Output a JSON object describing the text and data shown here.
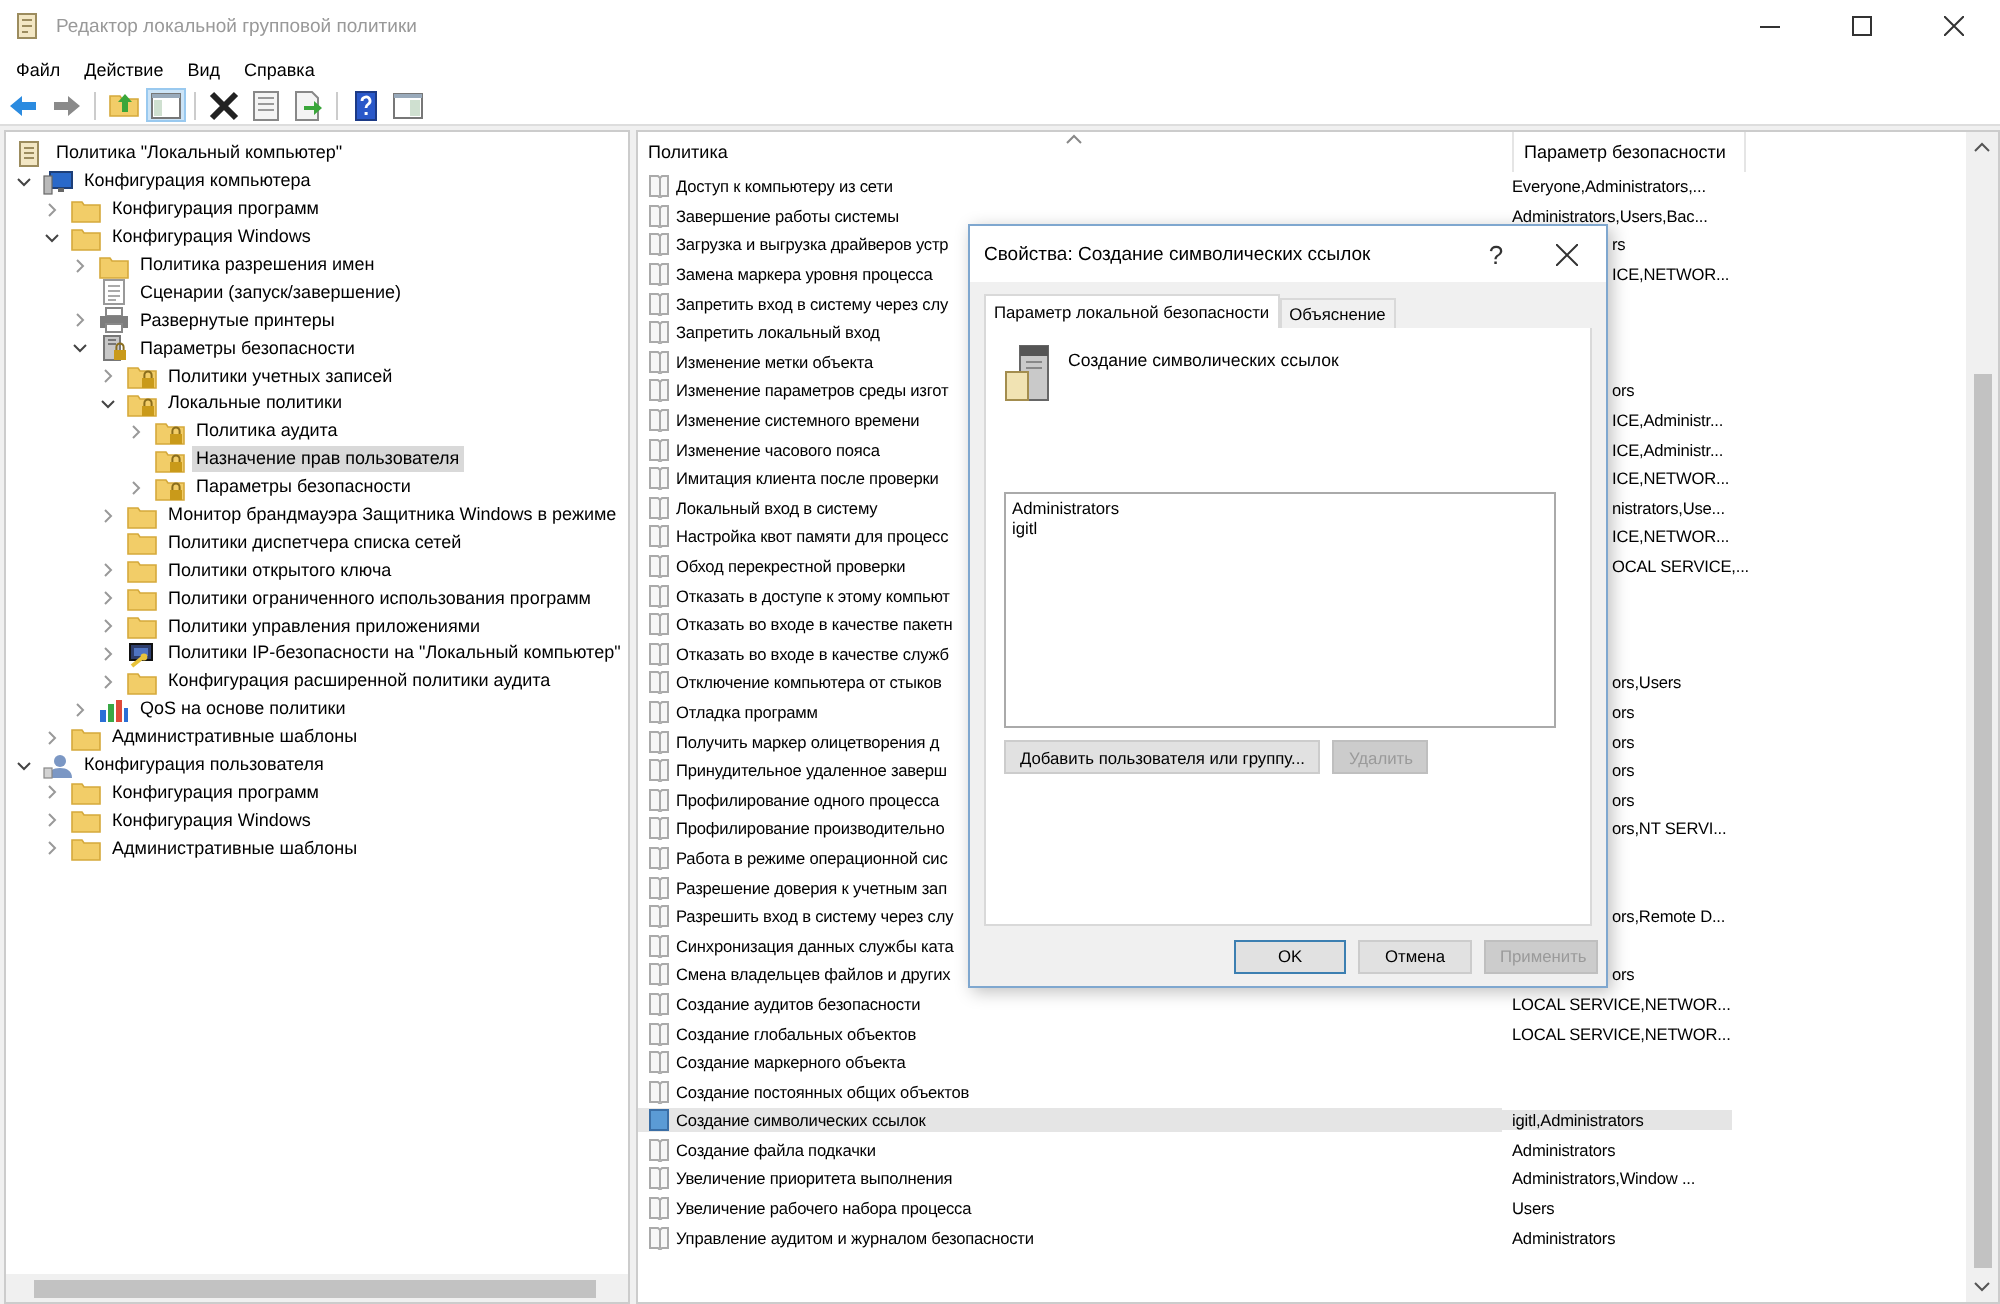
{
  "window": {
    "title": "Редактор локальной групповой политики"
  },
  "menu": [
    "Файл",
    "Действие",
    "Вид",
    "Справка"
  ],
  "toolbar": [
    {
      "kind": "back",
      "pressed": false
    },
    {
      "kind": "forward",
      "pressed": false
    },
    {
      "kind": "up",
      "pressed": false
    },
    {
      "kind": "tree",
      "pressed": true
    },
    {
      "kind": "delete",
      "pressed": false
    },
    {
      "kind": "properties",
      "pressed": false
    },
    {
      "kind": "export",
      "pressed": false
    },
    {
      "kind": "help",
      "pressed": false
    },
    {
      "kind": "pane",
      "pressed": false
    }
  ],
  "tree": [
    {
      "label": "Политика \"Локальный компьютер\"",
      "kind": "policy-doc",
      "selected": false,
      "children": [
        {
          "label": "Конфигурация компьютера",
          "kind": "computer",
          "expanded": true,
          "selected": false,
          "children": [
            {
              "label": "Конфигурация программ",
              "kind": "folder",
              "expanded": false,
              "selected": false
            },
            {
              "label": "Конфигурация Windows",
              "kind": "folder",
              "expanded": true,
              "selected": false,
              "children": [
                {
                  "label": "Политика разрешения имен",
                  "kind": "folder",
                  "expanded": false,
                  "selected": false
                },
                {
                  "label": "Сценарии (запуск/завершение)",
                  "kind": "script",
                  "selected": false
                },
                {
                  "label": "Развернутые принтеры",
                  "kind": "printer",
                  "expanded": false,
                  "selected": false
                },
                {
                  "label": "Параметры безопасности",
                  "kind": "server-lock",
                  "expanded": true,
                  "selected": false,
                  "children": [
                    {
                      "label": "Политики учетных записей",
                      "kind": "lock-folder",
                      "expanded": false,
                      "selected": false
                    },
                    {
                      "label": "Локальные политики",
                      "kind": "lock-folder",
                      "expanded": true,
                      "selected": false,
                      "children": [
                        {
                          "label": "Политика аудита",
                          "kind": "lock-folder",
                          "expanded": false,
                          "selected": false
                        },
                        {
                          "label": "Назначение прав пользователя",
                          "kind": "lock-folder",
                          "selected": true
                        },
                        {
                          "label": "Параметры безопасности",
                          "kind": "lock-folder",
                          "expanded": false,
                          "selected": false
                        }
                      ]
                    },
                    {
                      "label": "Монитор брандмауэра Защитника Windows в режиме",
                      "kind": "folder",
                      "expanded": false,
                      "selected": false
                    },
                    {
                      "label": "Политики диспетчера списка сетей",
                      "kind": "folder",
                      "selected": false
                    },
                    {
                      "label": "Политики открытого ключа",
                      "kind": "folder",
                      "expanded": false,
                      "selected": false
                    },
                    {
                      "label": "Политики ограниченного использования программ",
                      "kind": "folder",
                      "expanded": false,
                      "selected": false
                    },
                    {
                      "label": "Политики управления приложениями",
                      "kind": "folder",
                      "expanded": false,
                      "selected": false
                    },
                    {
                      "label": "Политики IP-безопасности на \"Локальный компьютер\"",
                      "kind": "ipsec",
                      "expanded": false,
                      "selected": false
                    },
                    {
                      "label": "Конфигурация расширенной политики аудита",
                      "kind": "folder",
                      "expanded": false,
                      "selected": false
                    }
                  ]
                },
                {
                  "label": "QoS на основе политики",
                  "kind": "qos",
                  "expanded": false,
                  "selected": false
                }
              ]
            },
            {
              "label": "Административные шаблоны",
              "kind": "folder",
              "expanded": false,
              "selected": false
            }
          ]
        },
        {
          "label": "Конфигурация пользователя",
          "kind": "user",
          "expanded": true,
          "selected": false,
          "children": [
            {
              "label": "Конфигурация программ",
              "kind": "folder",
              "expanded": false,
              "selected": false
            },
            {
              "label": "Конфигурация Windows",
              "kind": "folder",
              "expanded": false,
              "selected": false
            },
            {
              "label": "Административные шаблоны",
              "kind": "folder",
              "expanded": false,
              "selected": false
            }
          ]
        }
      ]
    }
  ],
  "table": {
    "columns": [
      "Политика",
      "Параметр безопасности"
    ],
    "rows": [
      {
        "policy": "Доступ к компьютеру из сети",
        "setting": "Everyone,Administrators,...",
        "selected": false
      },
      {
        "policy": "Завершение работы системы",
        "setting": "Administrators,Users,Bac...",
        "selected": false
      },
      {
        "policy": "Загрузка и выгрузка драйверов устр",
        "setting": "rs",
        "selected": false
      },
      {
        "policy": "Замена маркера уровня процесса",
        "setting": "ICE,NETWOR...",
        "selected": false
      },
      {
        "policy": "Запретить вход в систему через слу",
        "selected": false
      },
      {
        "policy": "Запретить локальный вход",
        "selected": false
      },
      {
        "policy": "Изменение метки объекта",
        "selected": false
      },
      {
        "policy": "Изменение параметров среды изгот",
        "setting": "ors",
        "selected": false
      },
      {
        "policy": "Изменение системного времени",
        "setting": "ICE,Administr...",
        "selected": false
      },
      {
        "policy": "Изменение часового пояса",
        "setting": "ICE,Administr...",
        "selected": false
      },
      {
        "policy": "Имитация клиента после проверки",
        "setting": "ICE,NETWOR...",
        "selected": false
      },
      {
        "policy": "Локальный вход в систему",
        "setting": "nistrators,Use...",
        "selected": false
      },
      {
        "policy": "Настройка квот памяти для процесс",
        "setting": "ICE,NETWOR...",
        "selected": false
      },
      {
        "policy": "Обход перекрестной проверки",
        "setting": "OCAL SERVICE,...",
        "selected": false
      },
      {
        "policy": "Отказать в доступе к этому компьют",
        "selected": false
      },
      {
        "policy": "Отказать во входе в качестве пакетн",
        "selected": false
      },
      {
        "policy": "Отказать во входе в качестве служб",
        "selected": false
      },
      {
        "policy": "Отключение компьютера от стыков",
        "setting": "ors,Users",
        "selected": false
      },
      {
        "policy": "Отладка программ",
        "setting": "ors",
        "selected": false
      },
      {
        "policy": "Получить маркер олицетворения д",
        "setting": "ors",
        "selected": false
      },
      {
        "policy": "Принудительное удаленное заверш",
        "setting": "ors",
        "selected": false
      },
      {
        "policy": "Профилирование одного процесса",
        "setting": "ors",
        "selected": false
      },
      {
        "policy": "Профилирование производительно",
        "setting": "ors,NT SERVI...",
        "selected": false
      },
      {
        "policy": "Работа в режиме операционной сис",
        "selected": false
      },
      {
        "policy": "Разрешение доверия к учетным зап",
        "selected": false
      },
      {
        "policy": "Разрешить вход в систему через слу",
        "setting": "ors,Remote D...",
        "selected": false
      },
      {
        "policy": "Синхронизация данных службы ката",
        "selected": false
      },
      {
        "policy": "Смена владельцев файлов и других",
        "setting": "ors",
        "selected": false
      },
      {
        "policy": "Создание аудитов безопасности",
        "setting": "LOCAL SERVICE,NETWOR...",
        "selected": false
      },
      {
        "policy": "Создание глобальных объектов",
        "setting": "LOCAL SERVICE,NETWOR...",
        "selected": false
      },
      {
        "policy": "Создание маркерного объекта",
        "selected": false
      },
      {
        "policy": "Создание постоянных общих объектов",
        "selected": false
      },
      {
        "policy": "Создание символических ссылок",
        "setting": "igitl,Administrators",
        "selected": true
      },
      {
        "policy": "Создание файла подкачки",
        "setting": "Administrators",
        "selected": false
      },
      {
        "policy": "Увеличение приоритета выполнения",
        "setting": "Administrators,Window ...",
        "selected": false
      },
      {
        "policy": "Увеличение рабочего набора процесса",
        "setting": "Users",
        "selected": false
      },
      {
        "policy": "Управление аудитом и журналом безопасности",
        "setting": "Administrators",
        "selected": false
      }
    ]
  },
  "dialog": {
    "title": "Свойства: Создание символических ссылок",
    "help": "?",
    "tabs": [
      {
        "label": "Параметр локальной безопасности",
        "selected": true
      },
      {
        "label": "Объяснение",
        "selected": false
      }
    ],
    "policy_name": "Создание символических ссылок",
    "members": [
      "Administrators",
      "igitl"
    ],
    "list_buttons": [
      {
        "label": "Добавить пользователя или группу...",
        "disabled": false
      },
      {
        "label": "Удалить",
        "disabled": true
      }
    ],
    "footer_buttons": [
      {
        "label": "OK",
        "default": true,
        "disabled": false
      },
      {
        "label": "Отмена",
        "default": false,
        "disabled": false
      },
      {
        "label": "Применить",
        "default": false,
        "disabled": true
      }
    ]
  }
}
